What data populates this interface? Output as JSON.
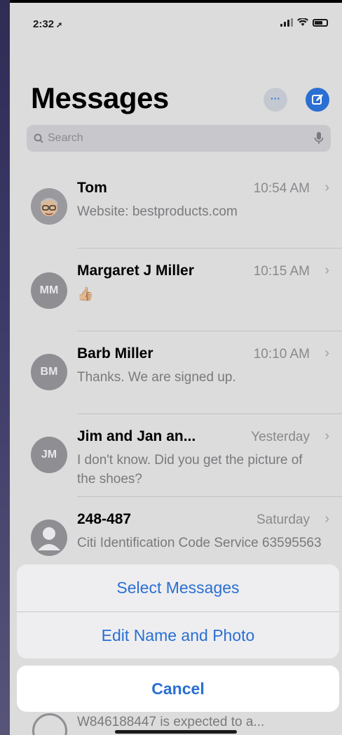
{
  "status_bar": {
    "time": "2:32",
    "location_arrow": "➚"
  },
  "header": {
    "title": "Messages",
    "more_label": "···"
  },
  "search": {
    "placeholder": "Search"
  },
  "conversations": [
    {
      "name": "Tom",
      "time": "10:54 AM",
      "preview": "Website: bestproducts.com",
      "avatar": "memoji",
      "initials": ""
    },
    {
      "name": "Margaret J Miller",
      "time": "10:15 AM",
      "preview": "👍🏼",
      "avatar": "initials",
      "initials": "MM"
    },
    {
      "name": "Barb Miller",
      "time": "10:10 AM",
      "preview": "Thanks. We are signed up.",
      "avatar": "initials",
      "initials": "BM"
    },
    {
      "name": "Jim and Jan an...",
      "time": "Yesterday",
      "preview": "I don't know. Did you get the picture of the shoes?",
      "avatar": "initials",
      "initials": "JM"
    },
    {
      "name": "248-487",
      "time": "Saturday",
      "preview": "Citi Identification Code Service 63595563",
      "avatar": "person",
      "initials": ""
    }
  ],
  "action_sheet": {
    "select_messages": "Select Messages",
    "edit_name_photo": "Edit Name and Photo",
    "cancel": "Cancel"
  },
  "bottom_peek_text": "W846188447 is expected to a...",
  "colors": {
    "accent": "#2a6fd2",
    "background": "#dcdcdc"
  }
}
